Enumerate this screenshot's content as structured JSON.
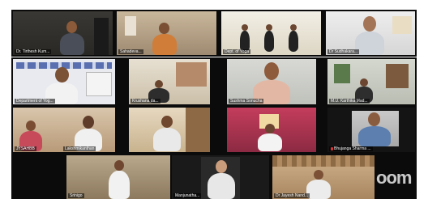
{
  "app": {
    "logo_text": "oom"
  },
  "tiles": [
    {
      "name": "Dr. Tirthesh Kum..."
    },
    {
      "name": "Sahadeva..."
    },
    {
      "name": "Dept. of Yoga"
    },
    {
      "name": "Dr Sudhakara..."
    },
    {
      "name": "Department of Yog...",
      "active": true
    },
    {
      "name": "Krushana da..."
    },
    {
      "name": "Sushma Sonucha"
    },
    {
      "name": "M.U. Karthika Mad..."
    },
    {
      "name": "JYSAHBB"
    },
    {
      "name": "Lakshmikanthan"
    },
    {
      "name": ""
    },
    {
      "name": "Bhujanga Sharma ..."
    },
    {
      "name": "Srinigo"
    },
    {
      "name": "Manjunatha..."
    },
    {
      "name": "Dr Jayesh Nand..."
    }
  ],
  "colors": {
    "active_border": "#7ee05a",
    "muted_mic": "#d33333"
  }
}
